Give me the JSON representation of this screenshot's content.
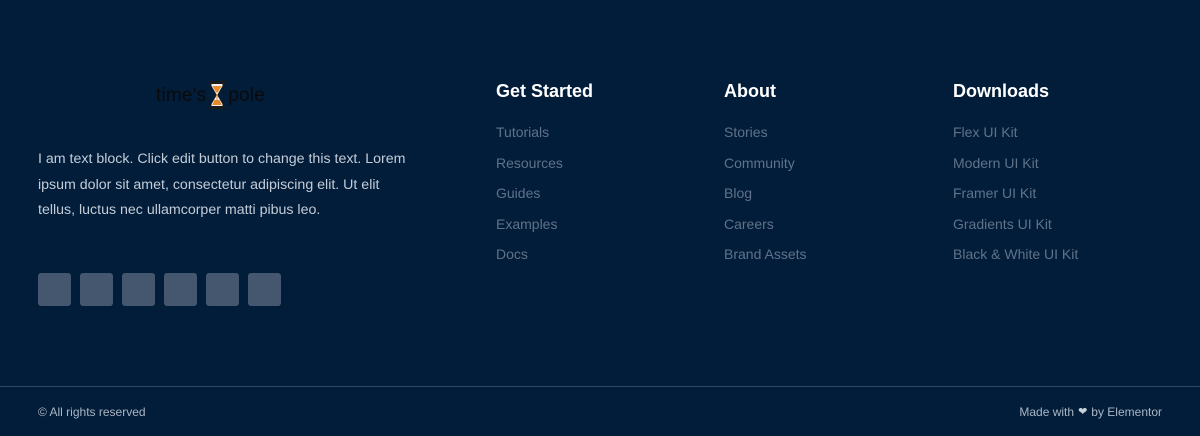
{
  "brand": {
    "logo_part1": "time's",
    "logo_part2": "pole",
    "logo_icon": "hourglass-icon",
    "description": "I am text block. Click edit button to change this text. Lorem ipsum dolor sit amet, consectetur adipiscing elit. Ut elit tellus, luctus nec ullamcorper matti pibus leo."
  },
  "socials": [
    {
      "icon": "social-icon-1"
    },
    {
      "icon": "social-icon-2"
    },
    {
      "icon": "social-icon-3"
    },
    {
      "icon": "social-icon-4"
    },
    {
      "icon": "social-icon-5"
    },
    {
      "icon": "social-icon-6"
    }
  ],
  "columns": [
    {
      "title": "Get Started",
      "links": [
        "Tutorials",
        "Resources",
        "Guides",
        "Examples",
        "Docs"
      ]
    },
    {
      "title": "About",
      "links": [
        "Stories",
        "Community",
        "Blog",
        "Careers",
        "Brand Assets"
      ]
    },
    {
      "title": "Downloads",
      "links": [
        "Flex UI Kit",
        "Modern UI Kit",
        "Framer UI Kit",
        "Gradients UI Kit",
        "Black & White UI Kit"
      ]
    }
  ],
  "bottom": {
    "copyright": "© All rights reserved",
    "made_with_prefix": "Made with",
    "heart_icon": "heart-icon",
    "made_with_suffix": "by Elementor"
  },
  "colors": {
    "background": "#021d3a",
    "heading": "#ffffff",
    "link": "#5f7289",
    "social_button": "#44576e",
    "logo_accent": "#e8892a"
  }
}
